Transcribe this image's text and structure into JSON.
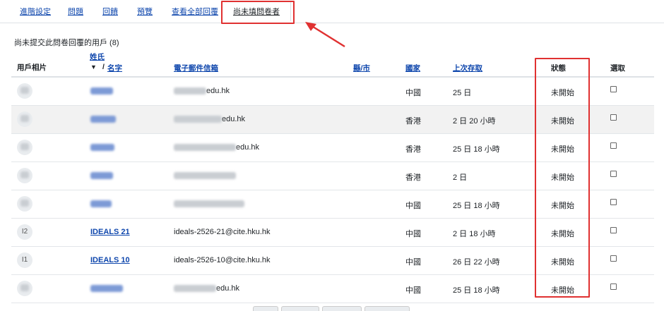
{
  "tabs": [
    {
      "label": "進階設定"
    },
    {
      "label": "問題"
    },
    {
      "label": "回饋"
    },
    {
      "label": "預覽"
    },
    {
      "label": "查看全部回覆"
    },
    {
      "label": "尚未填問卷者"
    }
  ],
  "subtitle": "尚未提交此問卷回覆的用戶 (8)",
  "headers": {
    "photo": "用戶相片",
    "surname": "姓氏",
    "sort_arrow": "▼",
    "slash": "/",
    "firstname": "名字",
    "email": "電子郵件信箱",
    "city": "縣/市",
    "country": "國家",
    "lastaccess": "上次存取",
    "status": "狀態",
    "select": "選取"
  },
  "rows": [
    {
      "avatar": "",
      "name": "",
      "email_suffix": "edu.hk",
      "country": "中國",
      "lastaccess": "25 日",
      "status": "未開始"
    },
    {
      "avatar": "",
      "name": "",
      "email_suffix": "edu.hk",
      "country": "香港",
      "lastaccess": "2 日 20 小時",
      "status": "未開始"
    },
    {
      "avatar": "",
      "name": "",
      "email_suffix": "edu.hk",
      "country": "香港",
      "lastaccess": "25 日 18 小時",
      "status": "未開始"
    },
    {
      "avatar": "",
      "name": "",
      "email_suffix": "",
      "country": "香港",
      "lastaccess": "2 日",
      "status": "未開始"
    },
    {
      "avatar": "",
      "name": "",
      "email_suffix": "",
      "country": "中國",
      "lastaccess": "25 日 18 小時",
      "status": "未開始"
    },
    {
      "avatar": "I2",
      "name": "IDEALS 21",
      "email": "ideals-2526-21@cite.hku.hk",
      "country": "中國",
      "lastaccess": "2 日 18 小時",
      "status": "未開始"
    },
    {
      "avatar": "I1",
      "name": "IDEALS 10",
      "email": "ideals-2526-10@cite.hku.hk",
      "country": "中國",
      "lastaccess": "26 日 22 小時",
      "status": "未開始"
    },
    {
      "avatar": "",
      "name": "",
      "email_suffix": "edu.hk",
      "country": "中國",
      "lastaccess": "25 日 18 小時",
      "status": "未開始"
    }
  ],
  "colors": {
    "link": "#0f47ad",
    "highlight": "#e03131",
    "shaded_row": "#f2f2f2"
  }
}
